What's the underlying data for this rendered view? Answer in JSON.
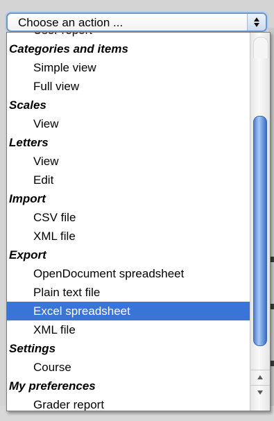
{
  "select": {
    "label": "Choose an action ..."
  },
  "menu": {
    "rows": [
      {
        "type": "option",
        "label": "User report"
      },
      {
        "type": "group",
        "label": "Categories and items"
      },
      {
        "type": "option",
        "label": "Simple view"
      },
      {
        "type": "option",
        "label": "Full view"
      },
      {
        "type": "group",
        "label": "Scales"
      },
      {
        "type": "option",
        "label": "View"
      },
      {
        "type": "group",
        "label": "Letters"
      },
      {
        "type": "option",
        "label": "View"
      },
      {
        "type": "option",
        "label": "Edit"
      },
      {
        "type": "group",
        "label": "Import"
      },
      {
        "type": "option",
        "label": "CSV file"
      },
      {
        "type": "option",
        "label": "XML file"
      },
      {
        "type": "group",
        "label": "Export"
      },
      {
        "type": "option",
        "label": "OpenDocument spreadsheet"
      },
      {
        "type": "option",
        "label": "Plain text file"
      },
      {
        "type": "option",
        "label": "Excel spreadsheet",
        "selected": true
      },
      {
        "type": "option",
        "label": "XML file"
      },
      {
        "type": "group",
        "label": "Settings"
      },
      {
        "type": "option",
        "label": "Course"
      },
      {
        "type": "group",
        "label": "My preferences"
      },
      {
        "type": "option",
        "label": "Grader report"
      }
    ]
  },
  "colors": {
    "selection": "#3875d7",
    "focus_ring": "#6f95c6",
    "scroll_thumb": "#6d9ce4"
  }
}
